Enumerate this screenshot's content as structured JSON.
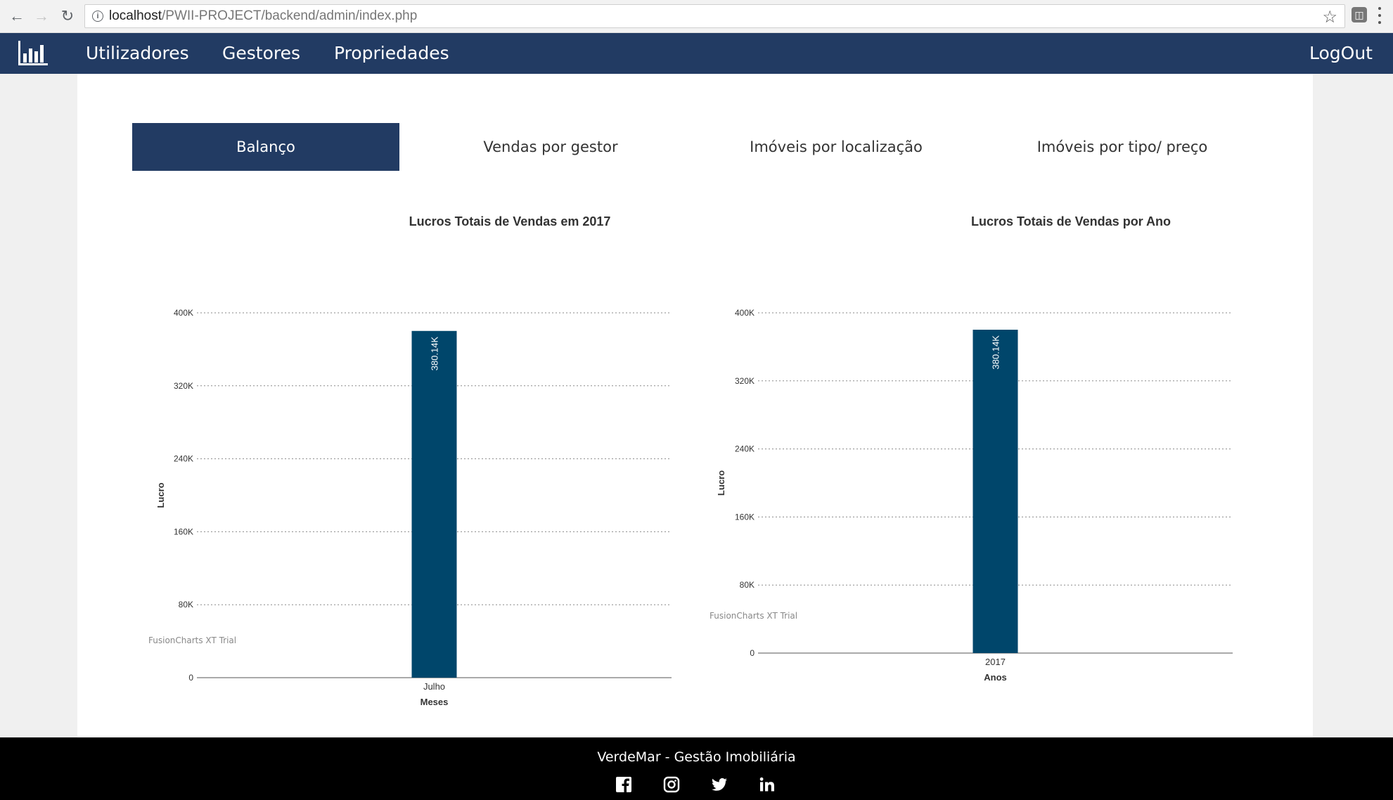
{
  "browser": {
    "url_host": "localhost",
    "url_path": "/PWII-PROJECT/backend/admin/index.php"
  },
  "navbar": {
    "items": [
      {
        "label": "Utilizadores"
      },
      {
        "label": "Gestores"
      },
      {
        "label": "Propriedades"
      }
    ],
    "logout_label": "LogOut"
  },
  "tabs": [
    {
      "label": "Balanço",
      "active": true
    },
    {
      "label": "Vendas por gestor",
      "active": false
    },
    {
      "label": "Imóveis por localização",
      "active": false
    },
    {
      "label": "Imóveis por tipo/ preço",
      "active": false
    }
  ],
  "chart_data": [
    {
      "type": "bar",
      "title": "Lucros Totais de Vendas em 2017",
      "xlabel": "Meses",
      "ylabel": "Lucro",
      "categories": [
        "Julho"
      ],
      "values": [
        380140
      ],
      "value_labels": [
        "380.14K"
      ],
      "ylim": [
        0,
        400000
      ],
      "yticks": [
        "0",
        "80K",
        "160K",
        "240K",
        "320K",
        "400K"
      ],
      "grid": true,
      "watermark": "FusionCharts XT Trial",
      "bar_color": "#00466b"
    },
    {
      "type": "bar",
      "title": "Lucros Totais de Vendas por Ano",
      "xlabel": "Anos",
      "ylabel": "Lucro",
      "categories": [
        "2017"
      ],
      "values": [
        380140
      ],
      "value_labels": [
        "380.14K"
      ],
      "ylim": [
        0,
        400000
      ],
      "yticks": [
        "0",
        "80K",
        "160K",
        "240K",
        "320K",
        "400K"
      ],
      "grid": true,
      "watermark": "FusionCharts XT Trial",
      "bar_color": "#00466b"
    }
  ],
  "footer": {
    "text": "VerdeMar - Gestão Imobiliária",
    "social_icons": [
      "facebook-icon",
      "instagram-icon",
      "twitter-icon",
      "linkedin-icon"
    ]
  }
}
